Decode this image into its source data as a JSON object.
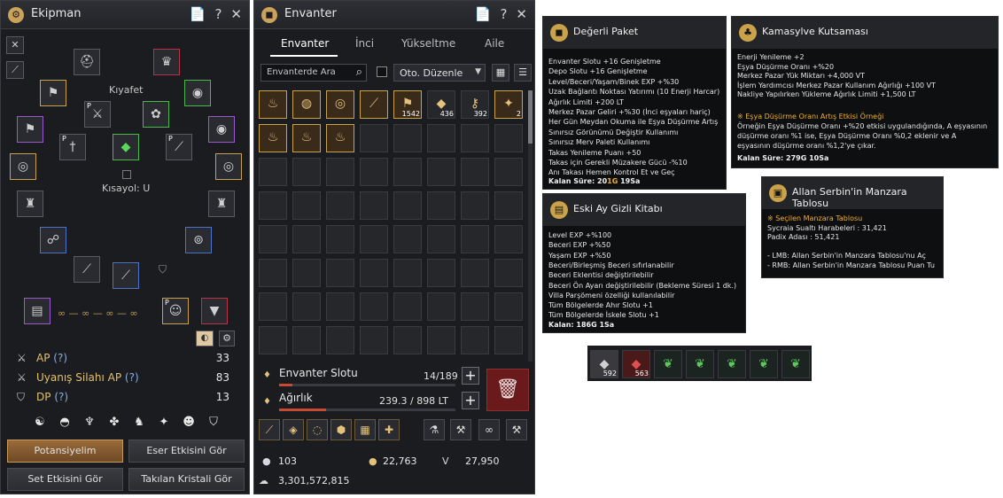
{
  "equipment": {
    "title": "Ekipman",
    "title_buttons": [
      "📄",
      "?",
      "✕"
    ],
    "outfit_label": "Kıyafet",
    "shortcut_label": "Kısayol: U",
    "stats": [
      {
        "name": "AP",
        "help": "(?)",
        "value": "33"
      },
      {
        "name": "Uyanış Silahı AP",
        "help": "(?)",
        "value": "83"
      },
      {
        "name": "DP",
        "help": "(?)",
        "value": "13"
      }
    ],
    "buttons": {
      "potential": "Potansiyelim",
      "artifact": "Eser Etkisini Gör",
      "set": "Set Etkisini Gör",
      "crystal": "Takılan Kristali Gör"
    }
  },
  "inventory": {
    "title": "Envanter",
    "title_buttons": [
      "📄",
      "?",
      "✕"
    ],
    "tabs": [
      "Envanter",
      "İnci",
      "Yükseltme",
      "Aile"
    ],
    "search_placeholder": "Envanterde Ara",
    "sort_label": "Oto. Düzenle",
    "items": [
      {
        "qty": "",
        "color": "gold"
      },
      {
        "qty": "",
        "color": "gold"
      },
      {
        "qty": "",
        "color": "gold"
      },
      {
        "qty": "",
        "color": "gold"
      },
      {
        "qty": "1542",
        "color": "gold"
      },
      {
        "qty": "436",
        "color": "none"
      },
      {
        "qty": "392",
        "color": "none"
      },
      {
        "qty": "2",
        "color": "gold"
      },
      {
        "qty": "",
        "color": "gold"
      },
      {
        "qty": "",
        "color": "gold"
      },
      {
        "qty": "",
        "color": "gold"
      }
    ],
    "slot_label": "Envanter Slotu",
    "slot_value": "14/189",
    "slot_fraction": 0.074,
    "weight_label": "Ağırlık",
    "weight_value": "239.3 / 898 LT",
    "weight_fraction": 0.266,
    "currency": {
      "pearls": "103",
      "cron": "22,763",
      "valks": "27,950",
      "silver": "3,301,572,815"
    }
  },
  "tooltips": {
    "value_pack": {
      "title": "Değerli Paket",
      "lines": [
        "Envanter Slotu +16 Genişletme",
        "Depo Slotu +16 Genişletme",
        "Level/Beceri/Yaşam/Binek EXP +%30",
        "Uzak Bağlantı Noktası Yatırımı (10 Enerji Harcar)",
        "Ağırlık Limiti +200 LT",
        "Merkez Pazar Geliri +%30 (İnci eşyaları hariç)",
        "Her Gün Meydan Okuma ile Eşya Düşürme Artış",
        "Sınırsız Görünümü Değiştir Kullanımı",
        "Sınırsız Merv Paleti Kullanımı",
        "Takas Yenileme Puanı +50",
        "Takas için Gerekli Müzakere Gücü -%10",
        "Anı Takası Hemen Kontrol Et ve Geç"
      ],
      "remaining": "Kalan Süre: 20",
      "remaining_g": "1G ",
      "remaining_h": "19Sa"
    },
    "kamasylve": {
      "title": "Kamasylve Kutsaması",
      "lines": [
        "Enerji Yenileme +2",
        "Eşya Düşürme Oranı +%20",
        "Merkez Pazar Yük Miktarı +4,000 VT",
        "İşlem Yardımcısı Merkez Pazar Kullanım Ağırlığı +100 VT",
        "Nakliye Yapılırken Yükleme Ağırlık Limiti +1,500 LT"
      ],
      "example_title": "※ Eşya Düşürme Oranı Artış Etkisi Örneği",
      "example_lines": [
        "Örneğin Eşya Düşürme Oranı +%20 etkisi uygulandığında, A eşyasının",
        "düşürme oranı %1 ise, Eşya Düşürme Oranı %0,2 eklenir ve A",
        "eşyasının düşürme oranı %1,2'ye çıkar."
      ],
      "remaining": "Kalan Süre: 279G 10Sa"
    },
    "old_moon": {
      "title": "Eski Ay Gizli Kitabı",
      "lines": [
        "Level EXP +%100",
        "Beceri EXP +%50",
        "Yaşam EXP +%50",
        "Beceri/Birleşmiş Beceri sıfırlanabilir",
        "Beceri Eklentisi değiştirilebilir",
        "Beceri Ön Ayarı değiştirilebilir (Bekleme Süresi 1 dk.)",
        "Villa Parşömeni özelliği kullanılabilir",
        "Tüm Bölgelerde Ahır Slotu +1",
        "Tüm Bölgelerde İskele Slotu +1"
      ],
      "remaining": "Kalan: 186G 1Sa"
    },
    "serbin": {
      "title": "Allan Serbin'in Manzara Tablosu",
      "lines": [
        "※ Seçilen Manzara Tablosu",
        "Sycraia Sualtı Harabeleri : 31,421",
        "Padix Adası : 51,421",
        "",
        "- LMB: Allan Serbin'in Manzara Tablosu'nu Aç",
        "- RMB: Allan Serbin'in Manzara Tablosu Puan Tu"
      ]
    }
  },
  "quickslots": [
    {
      "qty": "592"
    },
    {
      "qty": "563"
    },
    {
      "qty": ""
    },
    {
      "qty": ""
    },
    {
      "qty": ""
    },
    {
      "qty": ""
    },
    {
      "qty": ""
    }
  ],
  "colors": {
    "accent_gold": "#c9a24a",
    "danger_red": "#6a1a1a",
    "stat_yellow": "#e0c070",
    "tooltip_orange": "#f0b030"
  }
}
